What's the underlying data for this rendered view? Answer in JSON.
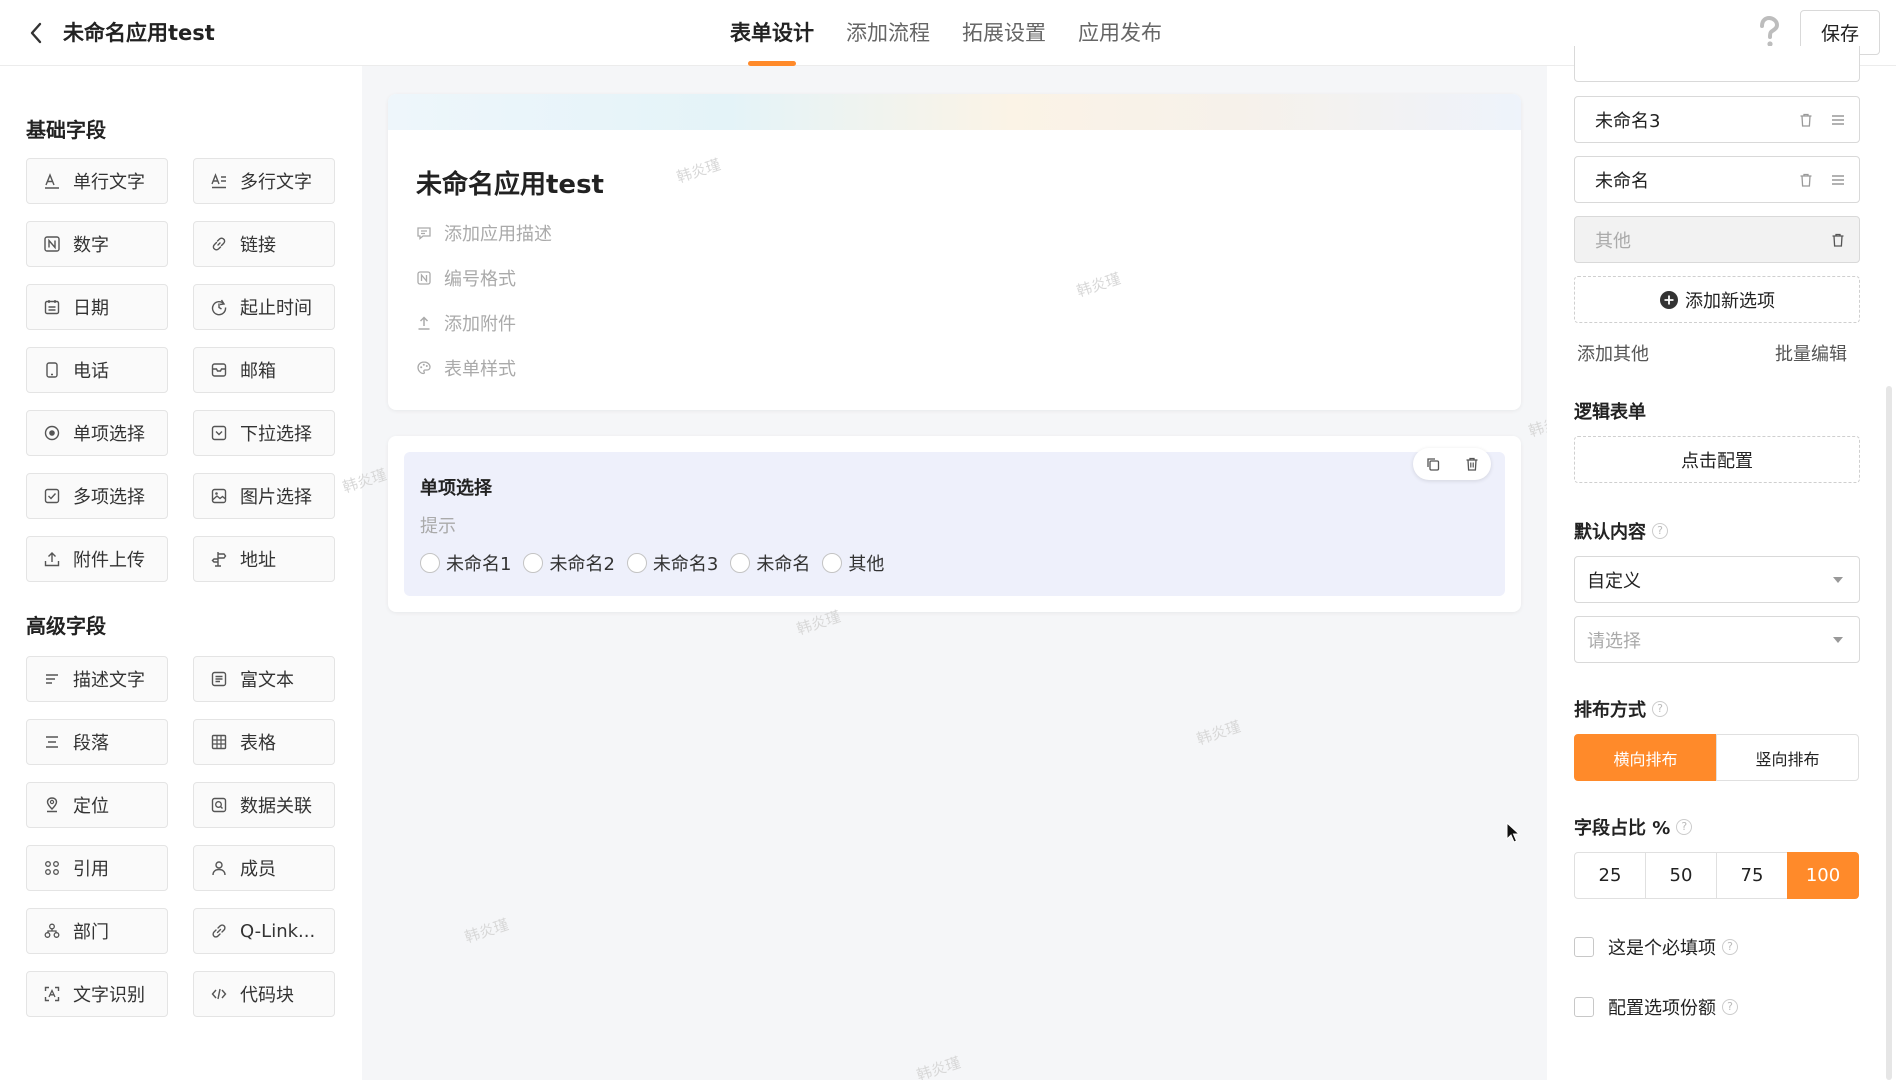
{
  "header": {
    "title": "未命名应用test",
    "tabs": [
      {
        "label": "表单设计",
        "active": true
      },
      {
        "label": "添加流程",
        "active": false
      },
      {
        "label": "拓展设置",
        "active": false
      },
      {
        "label": "应用发布",
        "active": false
      }
    ],
    "save_label": "保存"
  },
  "palette": {
    "basic_title": "基础字段",
    "basic_fields": [
      {
        "label": "单行文字",
        "icon": "single-line-text-icon"
      },
      {
        "label": "多行文字",
        "icon": "multi-line-text-icon"
      },
      {
        "label": "数字",
        "icon": "number-icon"
      },
      {
        "label": "链接",
        "icon": "link-icon"
      },
      {
        "label": "日期",
        "icon": "calendar-icon"
      },
      {
        "label": "起止时间",
        "icon": "time-range-icon"
      },
      {
        "label": "电话",
        "icon": "phone-icon"
      },
      {
        "label": "邮箱",
        "icon": "mail-icon"
      },
      {
        "label": "单项选择",
        "icon": "radio-icon"
      },
      {
        "label": "下拉选择",
        "icon": "dropdown-icon"
      },
      {
        "label": "多项选择",
        "icon": "checkbox-icon"
      },
      {
        "label": "图片选择",
        "icon": "image-icon"
      },
      {
        "label": "附件上传",
        "icon": "upload-icon"
      },
      {
        "label": "地址",
        "icon": "signpost-icon"
      }
    ],
    "advanced_title": "高级字段",
    "advanced_fields": [
      {
        "label": "描述文字",
        "icon": "description-icon"
      },
      {
        "label": "富文本",
        "icon": "rich-text-icon"
      },
      {
        "label": "段落",
        "icon": "paragraph-icon"
      },
      {
        "label": "表格",
        "icon": "table-icon"
      },
      {
        "label": "定位",
        "icon": "location-icon"
      },
      {
        "label": "数据关联",
        "icon": "data-link-icon"
      },
      {
        "label": "引用",
        "icon": "reference-icon"
      },
      {
        "label": "成员",
        "icon": "member-icon"
      },
      {
        "label": "部门",
        "icon": "department-icon"
      },
      {
        "label": "Q-Link...",
        "icon": "qlink-icon"
      },
      {
        "label": "文字识别",
        "icon": "ocr-icon"
      },
      {
        "label": "代码块",
        "icon": "code-icon"
      }
    ]
  },
  "canvas": {
    "form_title": "未命名应用test",
    "links": [
      {
        "label": "添加应用描述",
        "icon": "comment-icon"
      },
      {
        "label": "编号格式",
        "icon": "number-format-icon"
      },
      {
        "label": "添加附件",
        "icon": "attachment-upload-icon"
      },
      {
        "label": "表单样式",
        "icon": "palette-icon"
      }
    ],
    "field": {
      "label": "单项选择",
      "hint": "提示",
      "options": [
        "未命名1",
        "未命名2",
        "未命名3",
        "未命名",
        "其他"
      ]
    },
    "watermark": "韩炎瑾"
  },
  "props": {
    "options": [
      {
        "label": "未命名3"
      },
      {
        "label": "未命名"
      }
    ],
    "other_option": "其他",
    "add_option_label": "添加新选项",
    "add_other_label": "添加其他",
    "batch_edit_label": "批量编辑",
    "logic_title": "逻辑表单",
    "logic_button": "点击配置",
    "default_title": "默认内容",
    "default_select_value": "自定义",
    "default_select_placeholder": "请选择",
    "layout_title": "排布方式",
    "layout_options": [
      {
        "label": "横向排布",
        "active": true
      },
      {
        "label": "竖向排布",
        "active": false
      }
    ],
    "ratio_title": "字段占比 %",
    "ratio_options": [
      {
        "label": "25",
        "active": false
      },
      {
        "label": "50",
        "active": false
      },
      {
        "label": "75",
        "active": false
      },
      {
        "label": "100",
        "active": true
      }
    ],
    "required_label": "这是个必填项",
    "quota_label": "配置选项份额",
    "help_glyph": "?"
  },
  "colors": {
    "accent": "#ff8a2a",
    "field_bg": "#eef0fb",
    "canvas_bg": "#f5f6f8"
  }
}
